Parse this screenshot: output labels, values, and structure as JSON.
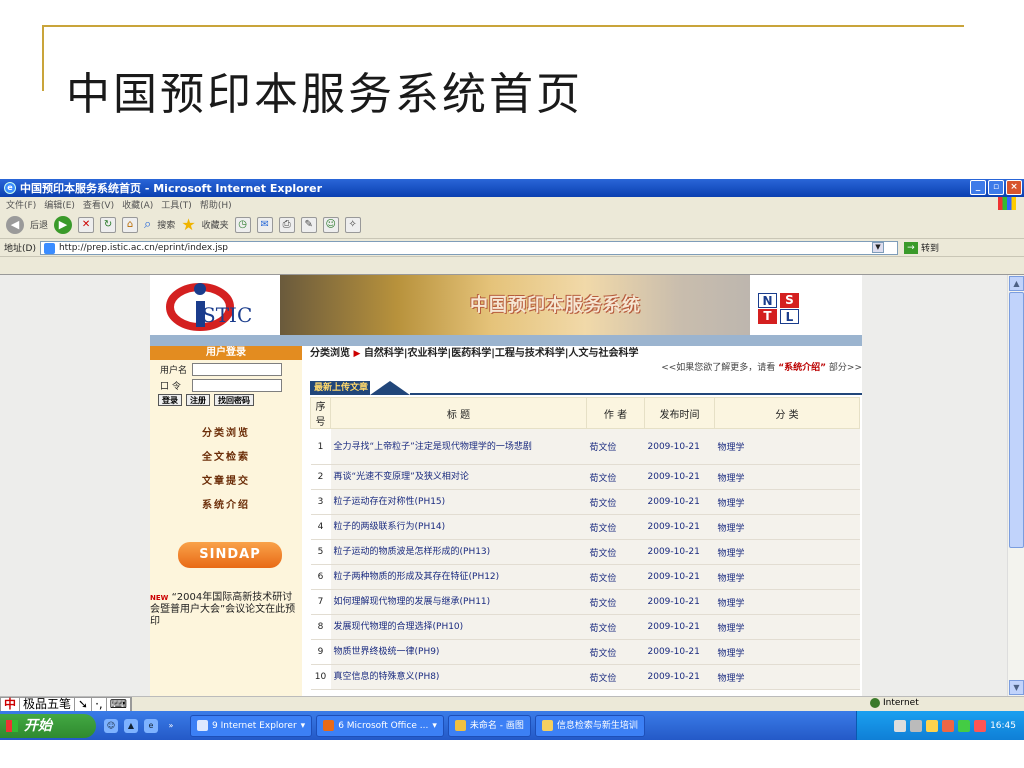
{
  "slide": {
    "title": "中国预印本服务系统首页"
  },
  "window": {
    "title": "中国预印本服务系统首页 - Microsoft Internet Explorer",
    "min": "_",
    "max": "▫",
    "close": "×"
  },
  "menu": [
    "文件(F)",
    "编辑(E)",
    "查看(V)",
    "收藏(A)",
    "工具(T)",
    "帮助(H)"
  ],
  "toolbar": {
    "back_label": "后退",
    "search_label": "搜索",
    "favorites_label": "收藏夹"
  },
  "address": {
    "label": "地址(D)",
    "url": "http://prep.istic.ac.cn/eprint/index.jsp",
    "go_label": "转到"
  },
  "banner": {
    "istic_text": "STIC",
    "title": "中国预印本服务系统",
    "nstl": [
      "N",
      "S",
      "T",
      "L"
    ]
  },
  "login": {
    "heading": "用户登录",
    "username_label": "用户名",
    "password_label": "口  令",
    "buttons": [
      "登录",
      "注册",
      "找回密码"
    ]
  },
  "nav": [
    "分类浏览",
    "全文检索",
    "文章提交",
    "系统介绍"
  ],
  "sindap": "SINDAP",
  "news": {
    "tag": "NEW",
    "text": "“2004年国际高新技术研讨会暨普用户大会”会议论文在此预印"
  },
  "categories": {
    "label": "分类浏览",
    "arrow": "▶",
    "items": "自然科学|农业科学|医药科学|工程与技术科学|人文与社会科学"
  },
  "more": {
    "prefix": "<<如果您欲了解更多，请看",
    "link": "“系统介绍”",
    "suffix": "部分>>"
  },
  "latest_label": "最新上传文章",
  "table": {
    "headers": [
      "序号",
      "标 题",
      "作 者",
      "发布时间",
      "分 类"
    ],
    "rows": [
      {
        "no": "1",
        "title": "全力寻找“上帝粒子”注定是现代物理学的一场悲剧",
        "author": "荀文俭",
        "date": "2009-10-21",
        "category": "物理学"
      },
      {
        "no": "2",
        "title": "再谈“光速不变原理”及狭义相对论",
        "author": "荀文俭",
        "date": "2009-10-21",
        "category": "物理学"
      },
      {
        "no": "3",
        "title": "粒子运动存在对称性(PH15)",
        "author": "荀文俭",
        "date": "2009-10-21",
        "category": "物理学"
      },
      {
        "no": "4",
        "title": "粒子的两级联系行为(PH14)",
        "author": "荀文俭",
        "date": "2009-10-21",
        "category": "物理学"
      },
      {
        "no": "5",
        "title": "粒子运动的物质波是怎样形成的(PH13)",
        "author": "荀文俭",
        "date": "2009-10-21",
        "category": "物理学"
      },
      {
        "no": "6",
        "title": "粒子两种物质的形成及其存在特征(PH12)",
        "author": "荀文俭",
        "date": "2009-10-21",
        "category": "物理学"
      },
      {
        "no": "7",
        "title": "如何理解现代物理的发展与继承(PH11)",
        "author": "荀文俭",
        "date": "2009-10-21",
        "category": "物理学"
      },
      {
        "no": "8",
        "title": "发展现代物理的合理选择(PH10)",
        "author": "荀文俭",
        "date": "2009-10-21",
        "category": "物理学"
      },
      {
        "no": "9",
        "title": "物质世界终极统一律(PH9)",
        "author": "荀文俭",
        "date": "2009-10-21",
        "category": "物理学"
      },
      {
        "no": "10",
        "title": "真空信息的特殊意义(PH8)",
        "author": "荀文俭",
        "date": "2009-10-21",
        "category": "物理学"
      }
    ]
  },
  "status": {
    "ime": [
      "中",
      "极品五笔",
      "➘",
      "·,",
      "⌨"
    ],
    "zone": "Internet"
  },
  "taskbar": {
    "start": "开始",
    "tasks": [
      "9 Internet Explorer",
      "6 Microsoft Office ...",
      "未命名 - 画图",
      "信息检索与新生培训"
    ],
    "clock": "16:45"
  }
}
